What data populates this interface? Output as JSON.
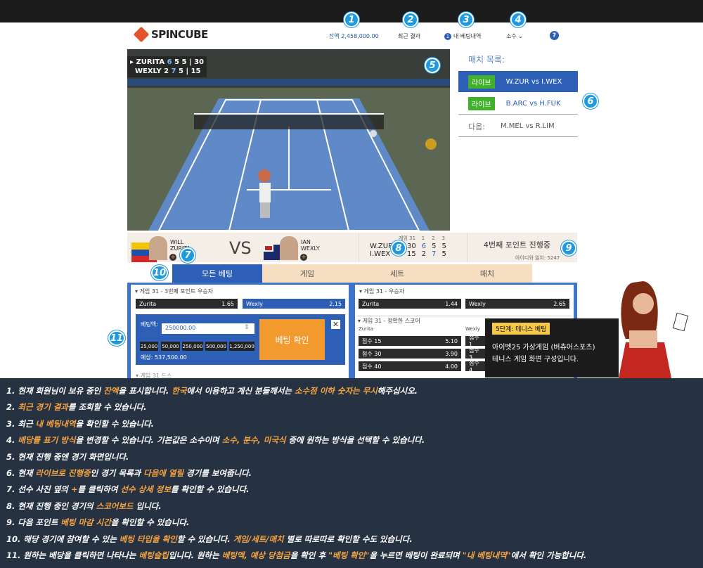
{
  "header": {
    "logo_text": "SPINCUBE",
    "balance": "잔액 2,458,000.00",
    "recent_results": "최근 결과",
    "my_bets_count": "1",
    "my_bets": "내 베팅내역",
    "odds_format": "소수",
    "help": "?"
  },
  "markers": [
    "1",
    "2",
    "3",
    "4",
    "5",
    "6",
    "7",
    "8",
    "9",
    "10",
    "11"
  ],
  "video": {
    "p1": "ZURITA",
    "p1_scores": [
      "6",
      "5",
      "5",
      "30"
    ],
    "p2": "WEXLY",
    "p2_scores": [
      "2",
      "7",
      "5",
      "15"
    ]
  },
  "match_list": {
    "title": "매치 목록:",
    "live_label": "라이브",
    "items": [
      {
        "label": "W.ZUR vs I.WEX",
        "active": true
      },
      {
        "label": "B.ARC vs H.FUK",
        "active": false
      }
    ],
    "next_label": "다음:",
    "next_match": "M.MEL vs R.LIM"
  },
  "band": {
    "player1_first": "WILL",
    "player1_last": "ZURITA",
    "vs": "VS",
    "player2_first": "IAN",
    "player2_last": "WEXLY",
    "game_label": "게임 31",
    "set_headers": [
      "1",
      "2",
      "3"
    ],
    "sb_p1": "W.ZUR",
    "sb_p1_pts": "30",
    "sb_p1_sets": [
      "6",
      "5",
      "5"
    ],
    "sb_p2": "I.WEX",
    "sb_p2_pts": "15",
    "sb_p2_sets": [
      "2",
      "7",
      "5"
    ],
    "point_status": "4번째 포인트 진행중",
    "match_id": "아이디와 일치: 5247"
  },
  "tabs": [
    "모든 베팅",
    "게임",
    "세트",
    "매치"
  ],
  "left_market": {
    "title": "게임 31 - 3번째 포인트 우승자",
    "odds": [
      {
        "name": "Zurita",
        "price": "1.65"
      },
      {
        "name": "Wexly",
        "price": "2.15"
      }
    ],
    "slip_label": "베팅액:",
    "stake": "250000.00",
    "quick_amounts": [
      "25,000",
      "50,000",
      "250,000",
      "500,000",
      "1,250,000"
    ],
    "expected": "예상: 537,500.00",
    "confirm": "베팅 확인",
    "next_market": "게임 31 드스"
  },
  "right_market": {
    "winner_title": "게임 31 - 우승자",
    "winner_odds": [
      {
        "name": "Zurita",
        "price": "1.44"
      },
      {
        "name": "Wexly",
        "price": "2.65"
      }
    ],
    "score_title": "게임 31 - 정확한 스코어",
    "col1": "Zurita",
    "col2": "Wexly",
    "scores": [
      {
        "name": "점수 15",
        "price": "5.10"
      },
      {
        "name": "점수 30",
        "price": "3.90"
      },
      {
        "name": "점수 40",
        "price": "4.00"
      }
    ],
    "scores2": [
      "점수 1",
      "점수 3",
      "점수 4"
    ]
  },
  "tip": {
    "badge": "5단계: 테니스 베팅",
    "line1": "아이벳25 가상게임 (버츄어스포츠)",
    "line2": "테니스 게임 화면 구성입니다."
  },
  "footer_lines": [
    [
      [
        "1. 현재 회원님이 보유 중인 ",
        0
      ],
      [
        "잔액",
        1
      ],
      [
        "을 표시합니다. ",
        0
      ],
      [
        "한국",
        1
      ],
      [
        "에서 이용하고 계신 분들께서는 ",
        0
      ],
      [
        "소수점 이하 숫자는 무시",
        1
      ],
      [
        "해주십시오.",
        0
      ]
    ],
    [
      [
        "2. ",
        0
      ],
      [
        "최근 경기 결과",
        1
      ],
      [
        "를 조회할 수 있습니다.",
        0
      ]
    ],
    [
      [
        "3. 최근 ",
        0
      ],
      [
        "내 베팅내역",
        1
      ],
      [
        "을 확인할 수 있습니다.",
        0
      ]
    ],
    [
      [
        "4. ",
        0
      ],
      [
        "배당률 표기 방식",
        1
      ],
      [
        "을 변경할 수 있습니다. 기본값은 소수이며 ",
        0
      ],
      [
        "소수, 분수, 미국식",
        1
      ],
      [
        " 중에 원하는 방식을 선택할 수 있습니다.",
        0
      ]
    ],
    [
      [
        "5. 현재 진행 중엔 경기 화면입니다.",
        0
      ]
    ],
    [
      [
        "6. 현재 ",
        0
      ],
      [
        "라이브로 진행중",
        1
      ],
      [
        "인 경기 목록과 ",
        0
      ],
      [
        "다음에 열릴",
        1
      ],
      [
        " 경기를 보여줍니다.",
        0
      ]
    ],
    [
      [
        "7. 선수 사진 옆의 ",
        0
      ],
      [
        "+",
        1
      ],
      [
        "를 클릭하여 ",
        0
      ],
      [
        "선수 상세 정보",
        1
      ],
      [
        "를 확인할 수 있습니다.",
        0
      ]
    ],
    [
      [
        "8. 현재 진행 중인 경기의 ",
        0
      ],
      [
        "스코어보드",
        1
      ],
      [
        " 입니다.",
        0
      ]
    ],
    [
      [
        "9. 다음 포인트 ",
        0
      ],
      [
        "베팅 마감 시간",
        1
      ],
      [
        "을 확인할 수 있습니다.",
        0
      ]
    ],
    [
      [
        "10. 해당 경기에 참여할 수 있는 ",
        0
      ],
      [
        "베팅 타입을 확인",
        1
      ],
      [
        "할 수 있습니다. ",
        0
      ],
      [
        "게임/세트/매치",
        1
      ],
      [
        " 별로 따로따로 확인할 수도 있습니다.",
        0
      ]
    ],
    [
      [
        "11. 원하는  배당을 클릭하면 나타나는 ",
        0
      ],
      [
        "베팅슬립",
        1
      ],
      [
        "입니다. 원하는 ",
        0
      ],
      [
        "베팅액, 예상 당첨금",
        1
      ],
      [
        "을 확인 후 ",
        0
      ],
      [
        "\"베팅 확인\"",
        1
      ],
      [
        "을 누르면 베팅이 완료되며 ",
        0
      ],
      [
        "\"내 베팅내역\"",
        1
      ],
      [
        "에서 확인 가능합니다.",
        0
      ]
    ]
  ]
}
